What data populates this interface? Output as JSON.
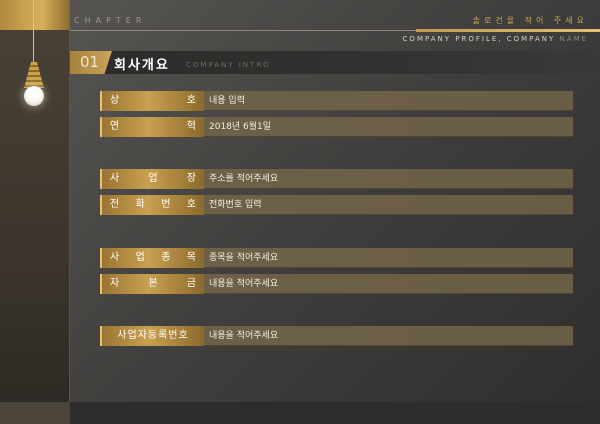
{
  "header": {
    "chapter": "CHAPTER",
    "title": "솔로건을 적어 주세요",
    "subheader_main": "COMPANY PROFILE, COMPANY",
    "subheader_dim": "NAME"
  },
  "section": {
    "number": "01",
    "title": "회사개요",
    "subtitle": "COMPANY INTRO"
  },
  "rows": [
    {
      "label_chars": [
        "상",
        "호"
      ],
      "value": "내용 입력"
    },
    {
      "label_chars": [
        "연",
        "혁"
      ],
      "value": "2018년 6월1일"
    },
    {
      "label_chars": [
        "사",
        "업",
        "장"
      ],
      "value": "주소를 적어주세요"
    },
    {
      "label_chars": [
        "전",
        "화",
        "번",
        "호"
      ],
      "value": "전화번호 입력"
    },
    {
      "label_chars": [
        "사",
        "업",
        "종",
        "목"
      ],
      "value": "종목을 적어주세요"
    },
    {
      "label_chars": [
        "자",
        "본",
        "금"
      ],
      "value": "내용을 적어주세요"
    },
    {
      "label": "사업자등록번호",
      "value": "내용을 적어주세요"
    }
  ],
  "colors": {
    "accent_gold": "#c9a050",
    "background": "#3f3e3c",
    "value_box": "#6d6048"
  }
}
